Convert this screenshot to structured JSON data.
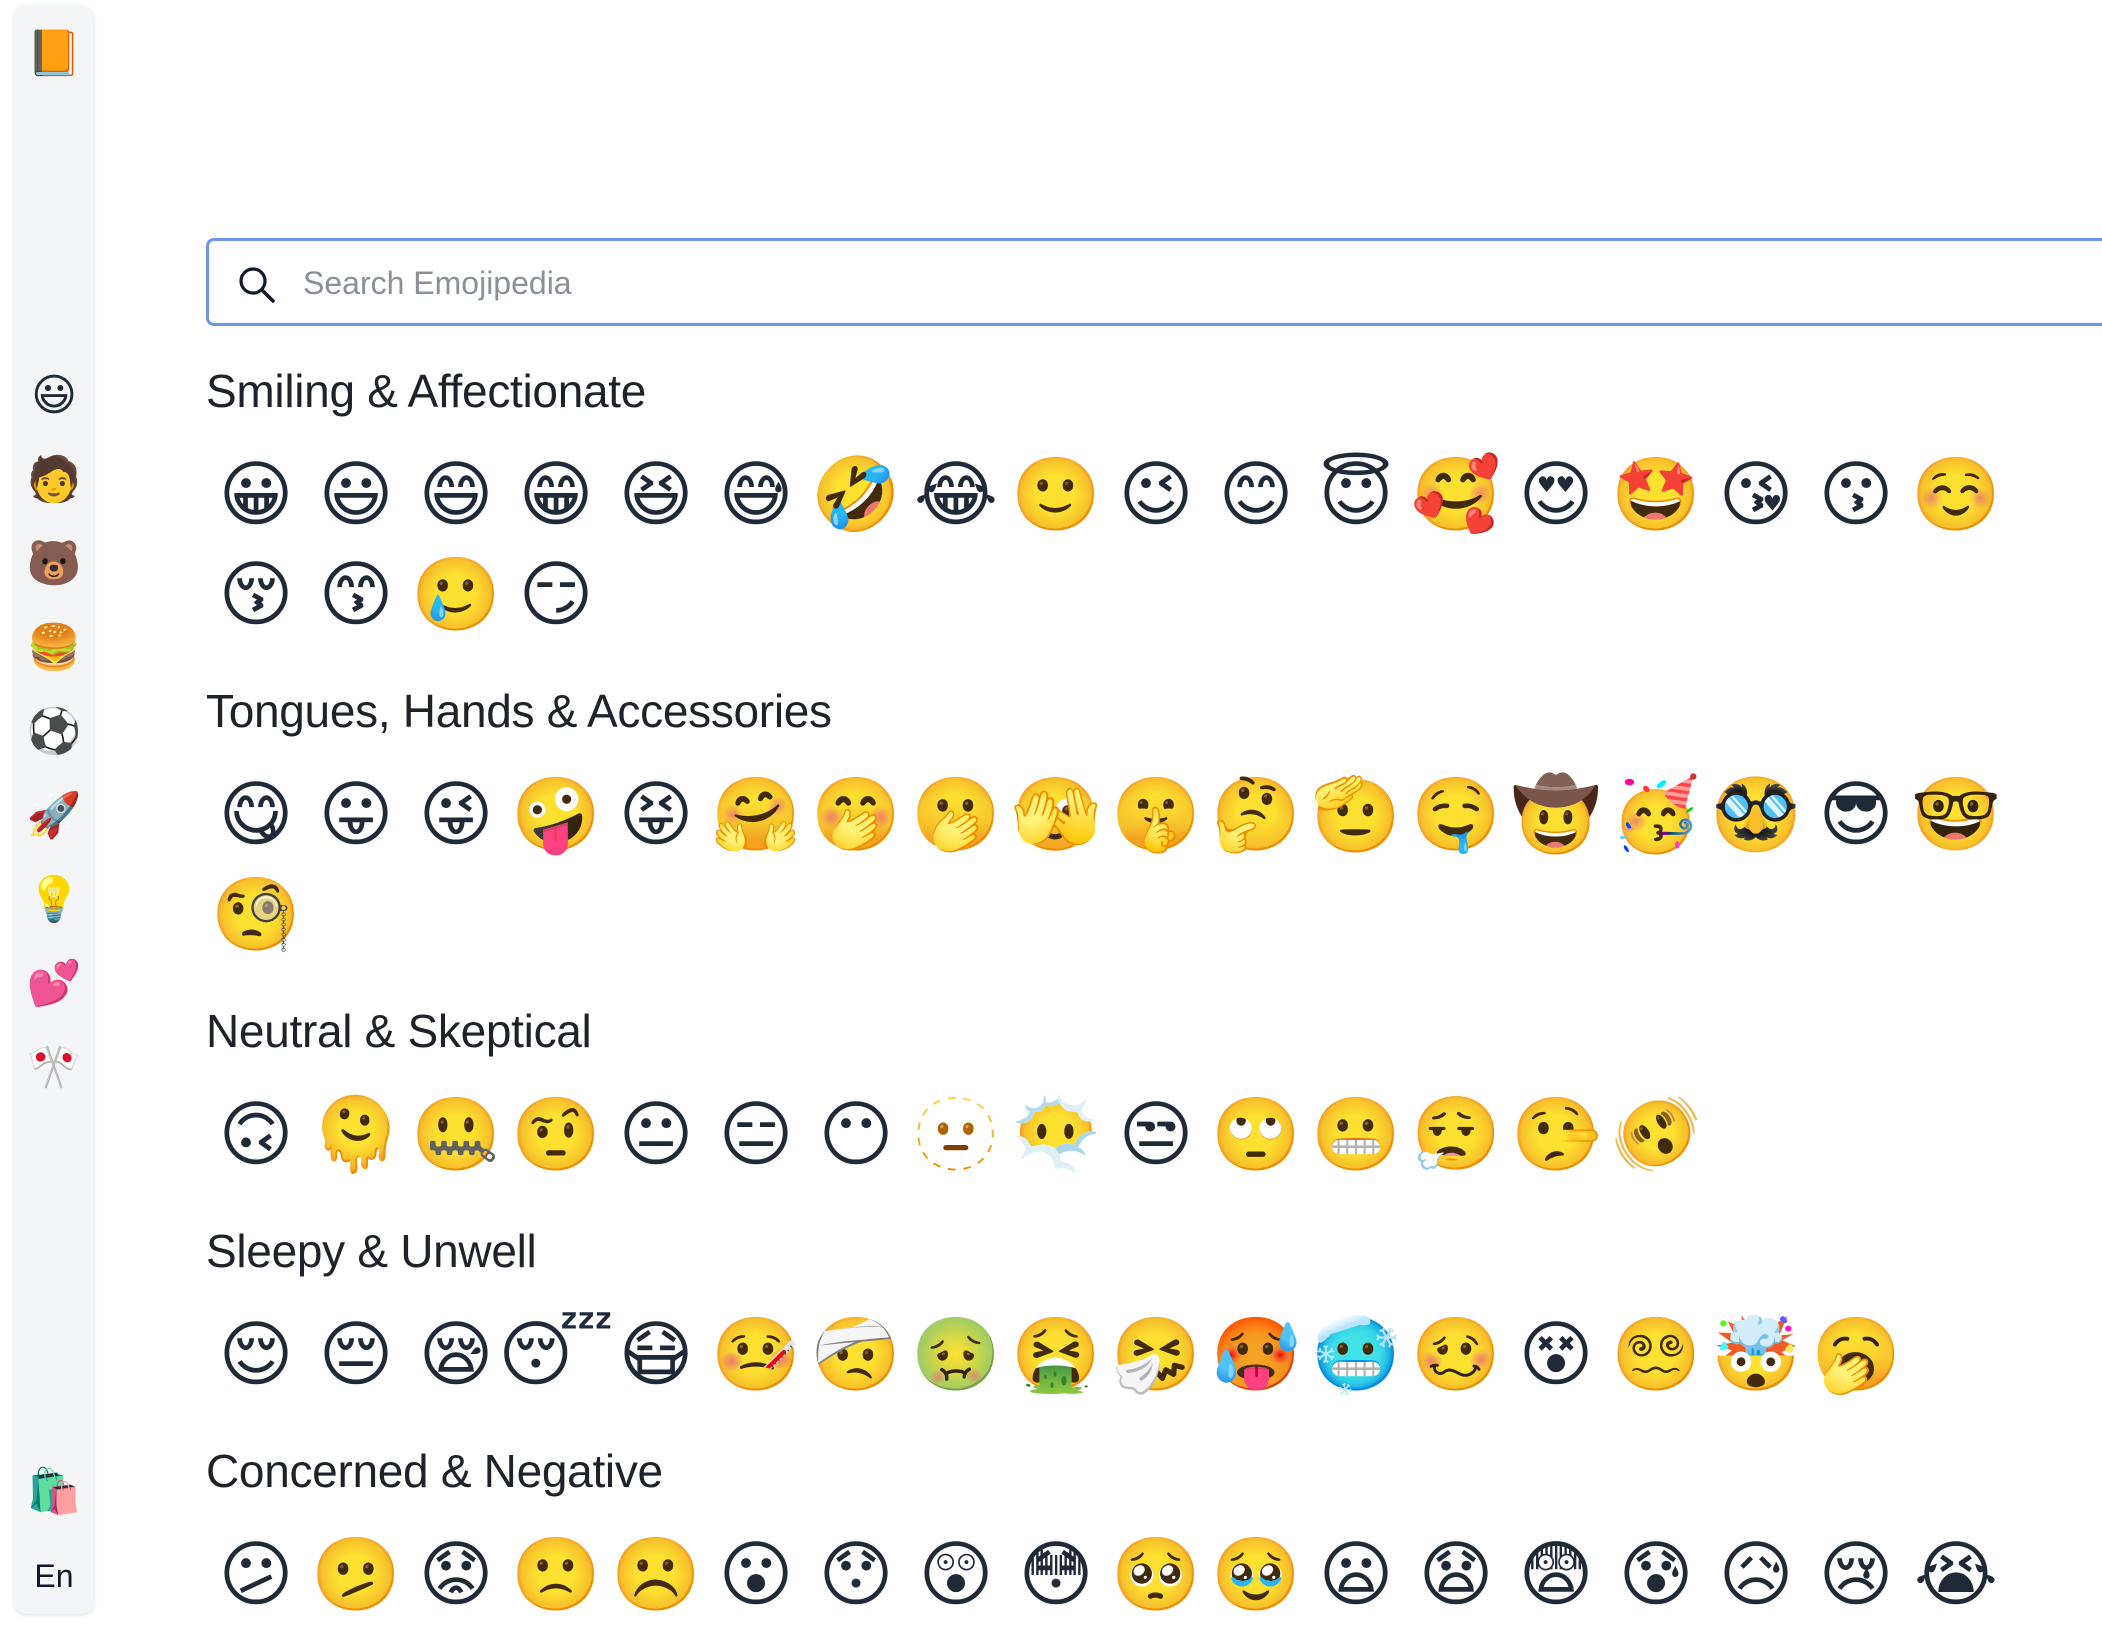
{
  "sidebar": {
    "logo": "📙",
    "items": [
      "😃",
      "🧑",
      "🐻",
      "🍔",
      "⚽",
      "🚀",
      "💡",
      "💕",
      "🎌"
    ],
    "shop": "🛍️",
    "language": "En"
  },
  "search": {
    "placeholder": "Search Emojipedia",
    "value": ""
  },
  "categories": [
    {
      "title": "Smiling & Affectionate",
      "emojis": [
        "😀",
        "😃",
        "😄",
        "😁",
        "😆",
        "😅",
        "🤣",
        "😂",
        "🙂",
        "😉",
        "😊",
        "😇",
        "🥰",
        "😍",
        "🤩",
        "😘",
        "😗",
        "☺️",
        "😚",
        "😙",
        "🥲",
        "😏"
      ]
    },
    {
      "title": "Tongues, Hands & Accessories",
      "emojis": [
        "😋",
        "😛",
        "😜",
        "🤪",
        "😝",
        "🤗",
        "🤭",
        "🫢",
        "🫣",
        "🤫",
        "🤔",
        "🫡",
        "🤤",
        "🤠",
        "🥳",
        "🥸",
        "😎",
        "🤓",
        "🧐"
      ]
    },
    {
      "title": "Neutral & Skeptical",
      "emojis": [
        "🙃",
        "🫠",
        "🤐",
        "🤨",
        "😐",
        "😑",
        "😶",
        "🫥",
        "😶‍🌫️",
        "😒",
        "🙄",
        "😬",
        "😮‍💨",
        "🤥",
        "🫨"
      ]
    },
    {
      "title": "Sleepy & Unwell",
      "emojis": [
        "😌",
        "😔",
        "😪",
        "😴",
        "😷",
        "🤒",
        "🤕",
        "🤢",
        "🤮",
        "🤧",
        "🥵",
        "🥶",
        "🥴",
        "😵",
        "😵‍💫",
        "🤯",
        "🥱"
      ]
    },
    {
      "title": "Concerned & Negative",
      "emojis": [
        "😕",
        "🫤",
        "😟",
        "🙁",
        "☹️",
        "😮",
        "😯",
        "😲",
        "😳",
        "🥺",
        "🥹",
        "😦",
        "😧",
        "😨",
        "😰",
        "😥",
        "😢",
        "😭"
      ]
    }
  ]
}
